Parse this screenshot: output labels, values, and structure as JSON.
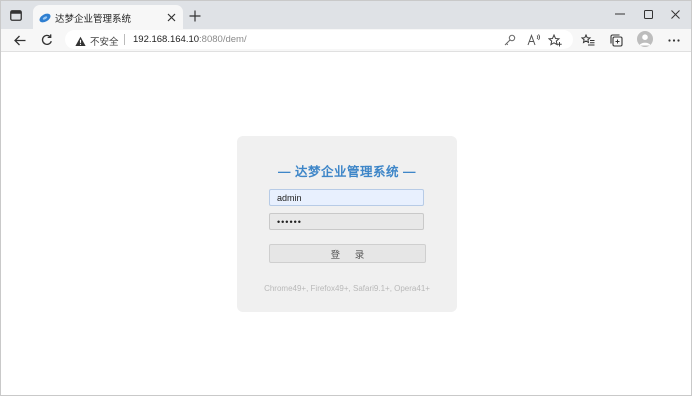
{
  "browser": {
    "tab": {
      "title": "达梦企业管理系统"
    },
    "address": {
      "security_label": "不安全",
      "url_host": "192.168.164.10",
      "url_rest": ":8080/dem/"
    }
  },
  "page": {
    "title": "— 达梦企业管理系统 —",
    "username_value": "admin",
    "password_value": "••••••",
    "login_button_label": "登 录",
    "browser_note": "Chrome49+, Firefox49+, Safari9.1+, Opera41+"
  },
  "icons": {
    "tab_actions": "tab-actions-icon",
    "favicon": "dm-logo-icon",
    "close": "close-icon",
    "new_tab": "plus-icon",
    "minimize": "minimize-icon",
    "maximize": "maximize-icon",
    "window_close": "close-icon",
    "back": "arrow-left-icon",
    "refresh": "refresh-icon",
    "warning": "warning-icon",
    "passwords": "key-icon",
    "read_aloud": "read-aloud-icon",
    "add_favorite": "star-plus-icon",
    "favorites": "favorites-list-icon",
    "collections": "collections-icon",
    "profile": "avatar",
    "more": "more-icon"
  },
  "colors": {
    "title_blue": "#3e86c8",
    "tabstrip": "#dfe2e6",
    "card_bg": "#f0f0f0",
    "autofill_bg": "#e8f0fe"
  }
}
